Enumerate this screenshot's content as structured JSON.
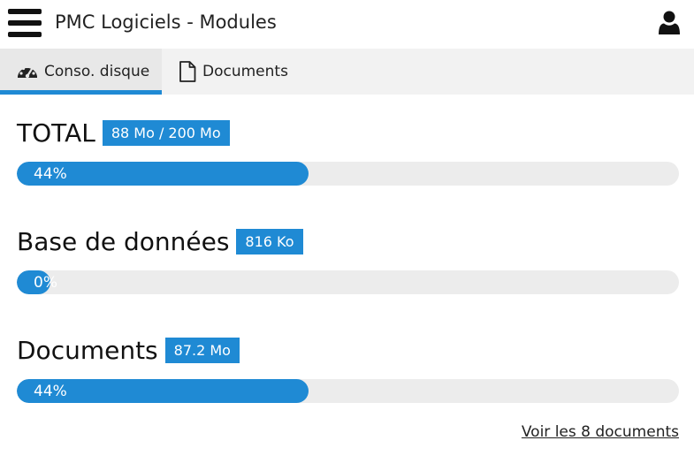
{
  "header": {
    "title": "PMC Logiciels - Modules",
    "menu_icon": "hamburger-menu-icon",
    "user_icon": "user-icon"
  },
  "tabs": [
    {
      "label": "Conso. disque",
      "icon": "dashboard-gauge-icon",
      "active": true
    },
    {
      "label": "Documents",
      "icon": "document-icon",
      "active": false
    }
  ],
  "sections": [
    {
      "title": "TOTAL",
      "badge": "88 Mo / 200 Mo",
      "percent_label": "44%",
      "percent": 44
    },
    {
      "title": "Base de données",
      "badge": "816 Ko",
      "percent_label": "0%",
      "percent": 0
    },
    {
      "title": "Documents",
      "badge": "87.2 Mo",
      "percent_label": "44%",
      "percent": 44
    }
  ],
  "link": {
    "label": "Voir les 8 documents"
  },
  "colors": {
    "accent": "#1f8ad4",
    "track": "#ececec",
    "tabbar": "#f2f2f2"
  }
}
